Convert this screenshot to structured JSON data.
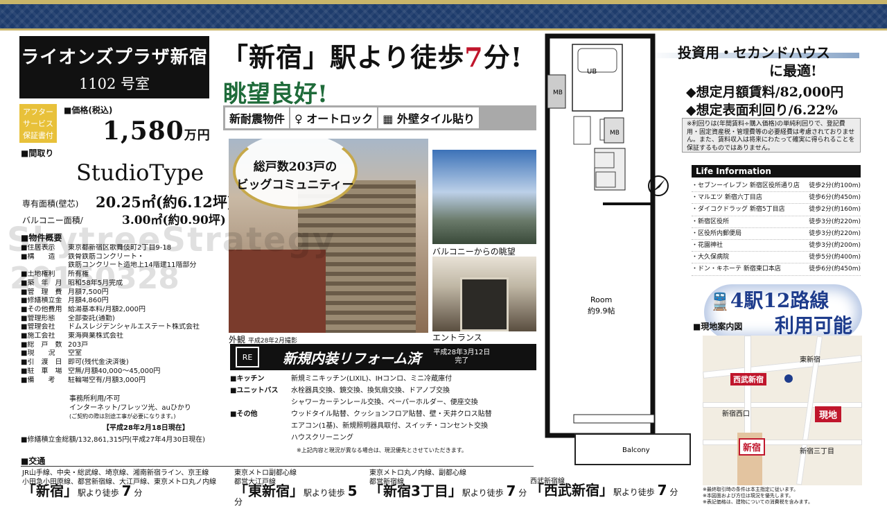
{
  "title": {
    "name": "ライオンズプラザ新宿",
    "room": "1102 号室"
  },
  "after_service": "アフターサービス保証書付",
  "price": {
    "label": "■価格(税込)",
    "value": "1,580",
    "unit": "万円"
  },
  "madori": {
    "label": "■間取り",
    "value": "StudioType"
  },
  "area": {
    "exclusive_label": "専有面積(壁芯)",
    "exclusive_value": "20.25㎡(約6.12坪)",
    "balcony_label": "バルコニー面積/",
    "balcony_value": "3.00㎡(約0.90坪)"
  },
  "spec_label": "■物件概要",
  "specs": [
    {
      "k": "■住居表示",
      "v": "東京都新宿区歌舞伎町2丁目9-18"
    },
    {
      "k": "■構　　造",
      "v": "鉄骨鉄筋コンクリート・"
    },
    {
      "k": "",
      "v": "鉄筋コンクリート造地上14階建11階部分"
    },
    {
      "k": "■土地権利",
      "v": "所有権"
    },
    {
      "k": "■築　年　月",
      "v": "昭和58年5月完成"
    },
    {
      "k": "■管　理　費",
      "v": "月額7,500円"
    },
    {
      "k": "■修繕積立金",
      "v": "月額4,860円"
    },
    {
      "k": "■その他費用",
      "v": "給湯基本料/月額2,000円"
    },
    {
      "k": "■管理形態",
      "v": "全部委託(通勤)"
    },
    {
      "k": "■管理会社",
      "v": "ドムスレジデンシャルエステート株式会社"
    },
    {
      "k": "■施工会社",
      "v": "東海興業株式会社"
    },
    {
      "k": "■総　戸　数",
      "v": "203戸"
    },
    {
      "k": "■現　　況",
      "v": "空室"
    },
    {
      "k": "■引　渡　日",
      "v": "即可(残代金決済後)"
    },
    {
      "k": "■駐　車　場",
      "v": "空無/月額40,000〜45,000円"
    },
    {
      "k": "■備　　考",
      "v": "駐輪場空有/月額3,000円"
    }
  ],
  "spec_extra": [
    "事務所利用/不可",
    "インターネット/フレッツ光、auひかり",
    "(ご契約の際は別途工事が必要になります。)"
  ],
  "spec_date": "【平成28年2月18日現在】",
  "repair_total": "■修繕積立金総額/132,861,315円(平成27年4月30日現在)",
  "traffic": {
    "label": "■交通",
    "stations": [
      {
        "lines": "JR山手線、中央・総武線、埼京線、湘南新宿ライン、京王線",
        "lines2": "小田急小田原線、都営新宿線、大江戸線、東京メトロ丸ノ内線",
        "name": "「新宿」",
        "walk_pre": "駅より徒歩",
        "min": "7",
        "unit": "分"
      },
      {
        "lines": "東京メトロ副都心線",
        "lines2": "都営大江戸線",
        "name": "「東新宿」",
        "walk_pre": "駅より徒歩",
        "min": "5",
        "unit": "分"
      },
      {
        "lines": "東京メトロ丸ノ内線、副都心線",
        "lines2": "都営新宿線",
        "name": "「新宿3丁目」",
        "walk_pre": "駅より徒歩",
        "min": "7",
        "unit": "分"
      },
      {
        "lines": "西武新宿線",
        "lines2": "",
        "name": "「西武新宿」",
        "walk_pre": "駅より徒歩",
        "min": "7",
        "unit": "分"
      }
    ]
  },
  "headline": {
    "pre": "「新宿」駅より徒歩",
    "num": "7",
    "post": "分!",
    "sub": "眺望良好!"
  },
  "features": [
    "新耐震物件",
    "♀ オートロック",
    "▦ 外壁タイル貼り"
  ],
  "community": "総戸数203戸のビッグコミュニティー",
  "community_l1": "総戸数203戸の",
  "community_l2": "ビッグコミュニティー",
  "photos": {
    "building_cap": "外観",
    "building_date": "平成28年2月撮影",
    "view_cap": "バルコニーからの眺望",
    "entrance_cap": "エントランス"
  },
  "reform": {
    "icon": "RE",
    "title": "新規内装リフォーム済",
    "date1": "平成28年3月12日",
    "date2": "完了",
    "items": [
      {
        "k": "■キッチン",
        "v": "新規ミニキッチン(LIXIL)、IHコンロ、ミニ冷蔵庫付"
      },
      {
        "k": "■ユニットバス",
        "v": "水栓器具交換、鏡交換、換気扇交換、ドアノブ交換"
      },
      {
        "k": "",
        "v": "シャワーカーテンレール交換、ペーパーホルダー、便座交換"
      },
      {
        "k": "■その他",
        "v": "ウッドタイル貼替、クッションフロア貼替、壁・天井クロス貼替"
      },
      {
        "k": "",
        "v": "エアコン(1基)、新規照明器具取付、スイッチ・コンセント交換"
      },
      {
        "k": "",
        "v": "ハウスクリーニング"
      }
    ],
    "note": "※上記内容と現況が異なる場合は、現況優先とさせていただきます。"
  },
  "floorplan": {
    "ub": "UB",
    "mb1": "MB",
    "mb2": "MB",
    "room": "Room",
    "room_size": "約9.9帖",
    "balcony": "Balcony"
  },
  "invest": {
    "t1": "投資用・セカンドハウス",
    "t2": "に最適!",
    "rent": "◆想定月額賃料/82,000円",
    "yield": "◆想定表面利回り/6.22%",
    "note": "※利回りは(年間賃料÷購入価格)の単純利回りで、登記費用・固定資産税・管理費等の必要経費は考慮されておりません。また、賃料収入は将来にわたって確実に得られることを保証するものではありません。"
  },
  "life": {
    "header": "Life Information",
    "items": [
      {
        "k": "・セブンーイレブン 新宿区役所通り店",
        "v": "徒歩2分(約100m)"
      },
      {
        "k": "・マルエツ 新宿六丁目店",
        "v": "徒歩6分(約450m)"
      },
      {
        "k": "・ダイコクドラッグ 新宿5丁目店",
        "v": "徒歩2分(約160m)"
      },
      {
        "k": "・新宿区役所",
        "v": "徒歩3分(約220m)"
      },
      {
        "k": "・区役所内郵便局",
        "v": "徒歩3分(約220m)"
      },
      {
        "k": "・花園神社",
        "v": "徒歩3分(約200m)"
      },
      {
        "k": "・大久保病院",
        "v": "徒歩5分(約400m)"
      },
      {
        "k": "・ドン・キホーテ 新宿東口本店",
        "v": "徒歩6分(約450m)"
      }
    ]
  },
  "eki": {
    "t1": "4駅12路線",
    "t2": "利用可能"
  },
  "map": {
    "label": "■現地案内図",
    "genchi": "現地",
    "nishi": "西武新宿",
    "shinjuku": "新宿",
    "higashi": "東新宿",
    "sanchome": "新宿三丁目",
    "nishiguchi": "新宿西口"
  },
  "foot_notes": [
    "※最終取引時の条件は本主指定に従います。",
    "※本図面および方位は現況を優先します。",
    "※表記価格は、建物についての消費税を含みます。"
  ],
  "watermark": {
    "l1": "SkytreeStrategy",
    "l2": "20160328"
  }
}
